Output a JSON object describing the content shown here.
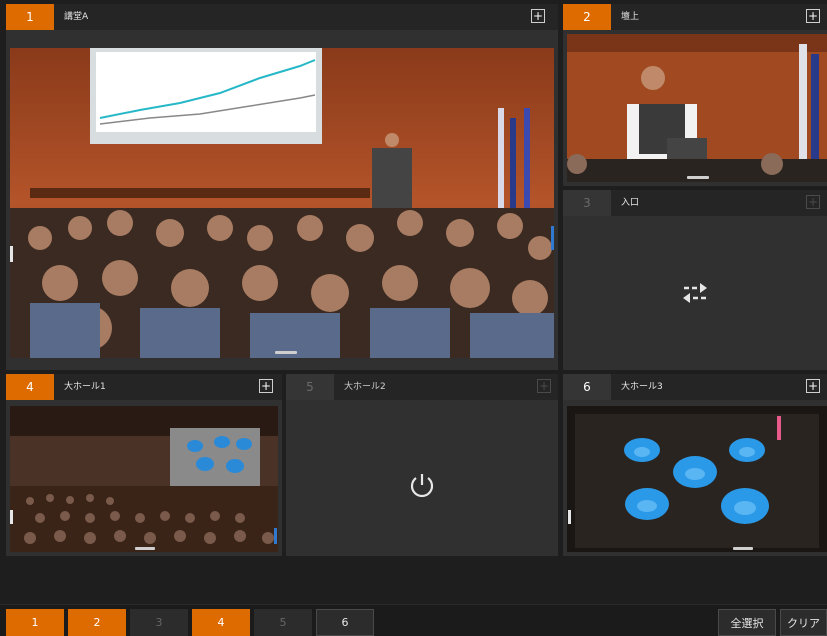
{
  "panels": [
    {
      "num": "1",
      "title": "講堂A",
      "plus": "+",
      "active": true
    },
    {
      "num": "2",
      "title": "壇上",
      "plus": "+",
      "active": true
    },
    {
      "num": "3",
      "title": "入口",
      "plus": "+",
      "active": false
    },
    {
      "num": "4",
      "title": "大ホール1",
      "plus": "+",
      "active": true
    },
    {
      "num": "5",
      "title": "大ホール2",
      "plus": "+",
      "active": false
    },
    {
      "num": "6",
      "title": "大ホール3",
      "plus": "+",
      "active": true
    }
  ],
  "panel_icons": {
    "3": "swap-arrows-icon",
    "5": "power-icon"
  },
  "bottom_tabs": [
    {
      "label": "1",
      "state": "on"
    },
    {
      "label": "2",
      "state": "on"
    },
    {
      "label": "3",
      "state": "off"
    },
    {
      "label": "4",
      "state": "on"
    },
    {
      "label": "5",
      "state": "off"
    },
    {
      "label": "6",
      "state": "plain"
    }
  ],
  "buttons": {
    "select_all": "全選択",
    "clear": "クリア"
  },
  "colors": {
    "accent": "#dd6b00",
    "background": "#1e1e1e",
    "panel": "#303030"
  }
}
